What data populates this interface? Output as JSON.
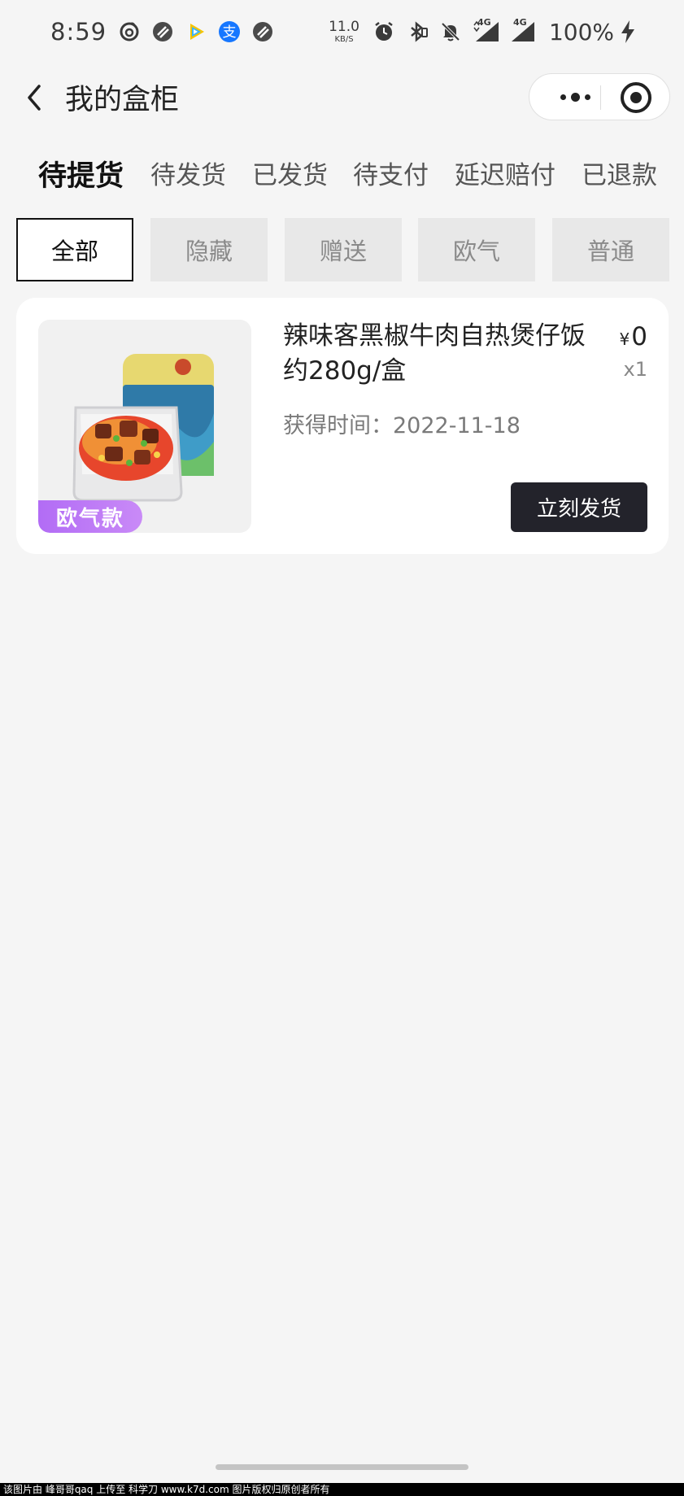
{
  "status_bar": {
    "time": "8:59",
    "net_speed_value": "11.0",
    "net_speed_unit": "KB/S",
    "network_label_1": "4G",
    "network_label_2": "4G",
    "battery": "100%",
    "icons": [
      "netease-music-icon",
      "app-icon",
      "tencent-video-icon",
      "alipay-icon",
      "app-icon",
      "alarm-icon",
      "bluetooth-icon",
      "mute-icon",
      "signal-icon",
      "signal-icon",
      "charging-icon"
    ],
    "alipay_glyph": "支"
  },
  "header": {
    "title": "我的盒柜"
  },
  "status_tabs": [
    {
      "label": "待提货",
      "active": true
    },
    {
      "label": "待发货",
      "active": false
    },
    {
      "label": "已发货",
      "active": false
    },
    {
      "label": "待支付",
      "active": false
    },
    {
      "label": "延迟赔付",
      "active": false
    },
    {
      "label": "已退款",
      "active": false
    }
  ],
  "filter_chips": [
    {
      "label": "全部",
      "active": true
    },
    {
      "label": "隐藏",
      "active": false
    },
    {
      "label": "赠送",
      "active": false
    },
    {
      "label": "欧气",
      "active": false
    },
    {
      "label": "普通",
      "active": false
    }
  ],
  "items": [
    {
      "badge": "欧气款",
      "name": "辣味客黑椒牛肉自热煲仔饭约280g/盒",
      "currency": "¥",
      "price": "0",
      "quantity": "x1",
      "obtain_label": "获得时间：2022-11-18",
      "action_label": "立刻发货"
    }
  ],
  "watermark": "该图片由 峰哥哥qaq 上传至 科学刀 www.k7d.com 图片版权归原创者所有",
  "colors": {
    "background": "#f5f5f5",
    "badge_purple": "#b26cf5",
    "button_dark": "#23232b",
    "alipay_blue": "#1677ff"
  }
}
